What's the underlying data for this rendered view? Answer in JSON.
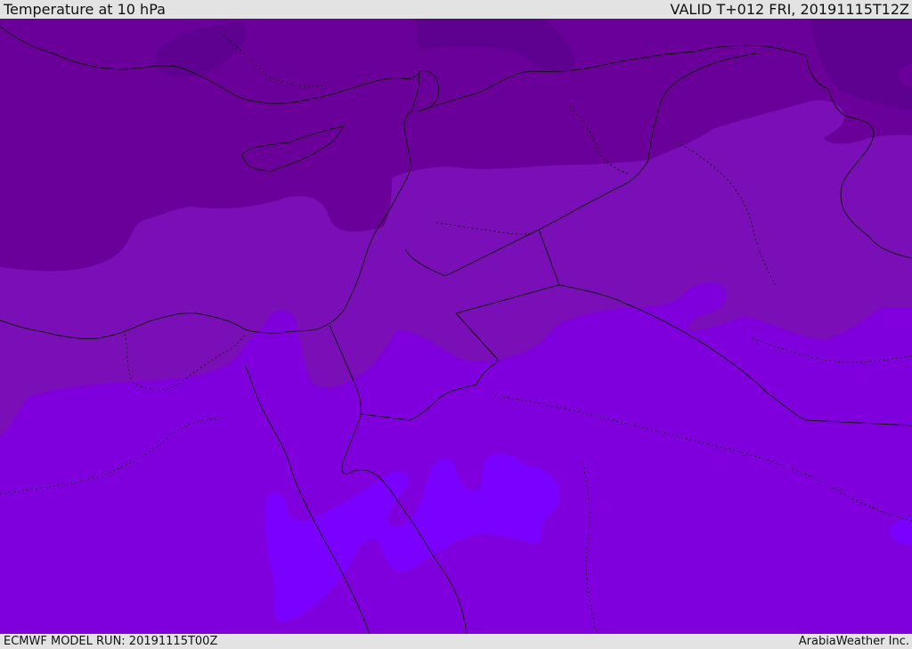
{
  "header": {
    "title": "Temperature at 10 hPa",
    "valid_time": "VALID T+012 FRI, 20191115T12Z"
  },
  "footer": {
    "model_run": "ECMWF MODEL RUN: 20191115T00Z",
    "credit": "ArabiaWeather Inc."
  },
  "map": {
    "variable": "Temperature",
    "level": "10 hPa",
    "colors": {
      "band_coldest": "#5e0090",
      "band_cold": "#6a0099",
      "band_mid": "#7a0fb8",
      "band_warm": "#7f00dd",
      "band_warmest": "#7a00ff",
      "boundary_line": "#111111"
    }
  }
}
